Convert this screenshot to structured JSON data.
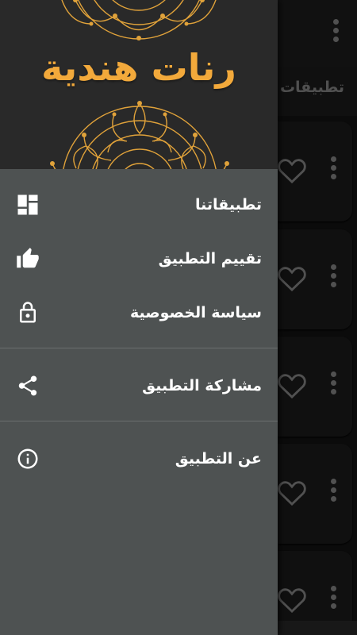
{
  "background": {
    "tab_label": "تطبيقات ال",
    "cards": [
      {
        "heart_icon": "heart-outline-icon",
        "menu_icon": "vertical-dots-icon"
      },
      {
        "heart_icon": "heart-outline-icon",
        "menu_icon": "vertical-dots-icon"
      },
      {
        "heart_icon": "heart-outline-icon",
        "menu_icon": "vertical-dots-icon"
      },
      {
        "heart_icon": "heart-outline-icon",
        "menu_icon": "vertical-dots-icon"
      },
      {
        "heart_icon": "heart-outline-icon",
        "menu_icon": "vertical-dots-icon"
      }
    ]
  },
  "drawer": {
    "header_title": "رنات هندية",
    "accent_color": "#f2a93b",
    "items": [
      {
        "label": "تطبيقاتنا",
        "icon": "dashboard-icon"
      },
      {
        "label": "تقييم التطبيق",
        "icon": "thumbs-up-icon"
      },
      {
        "label": "سياسة الخصوصية",
        "icon": "lock-icon"
      },
      {
        "label": "مشاركة التطبيق",
        "icon": "share-icon"
      },
      {
        "label": "عن التطبيق",
        "icon": "info-icon"
      }
    ]
  }
}
